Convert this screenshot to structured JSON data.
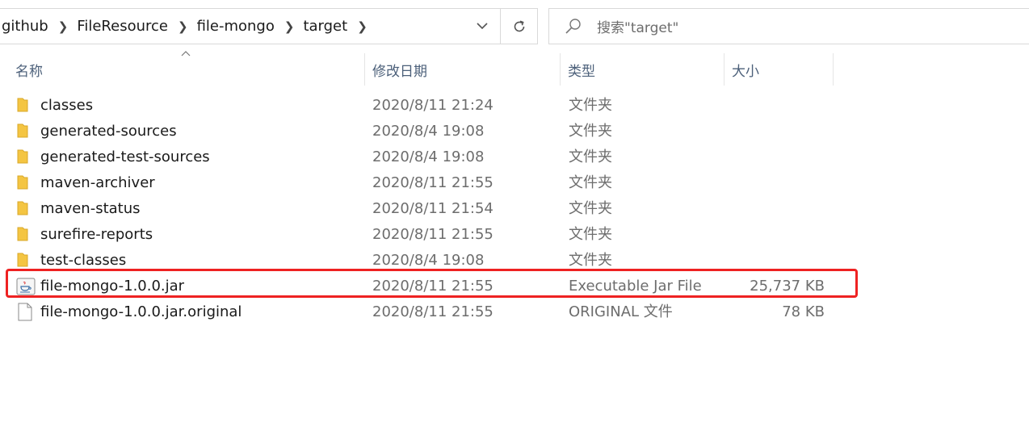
{
  "address_bar": {
    "crumbs": [
      "github",
      "FileResource",
      "file-mongo",
      "target"
    ]
  },
  "search": {
    "placeholder": "搜索\"target\""
  },
  "columns": {
    "name": "名称",
    "date": "修改日期",
    "type": "类型",
    "size": "大小"
  },
  "files": [
    {
      "name": "classes",
      "date": "2020/8/11 21:24",
      "type": "文件夹",
      "size": "",
      "icon": "folder-icon"
    },
    {
      "name": "generated-sources",
      "date": "2020/8/4 19:08",
      "type": "文件夹",
      "size": "",
      "icon": "folder-icon"
    },
    {
      "name": "generated-test-sources",
      "date": "2020/8/4 19:08",
      "type": "文件夹",
      "size": "",
      "icon": "folder-icon"
    },
    {
      "name": "maven-archiver",
      "date": "2020/8/11 21:55",
      "type": "文件夹",
      "size": "",
      "icon": "folder-icon"
    },
    {
      "name": "maven-status",
      "date": "2020/8/11 21:54",
      "type": "文件夹",
      "size": "",
      "icon": "folder-icon"
    },
    {
      "name": "surefire-reports",
      "date": "2020/8/11 21:55",
      "type": "文件夹",
      "size": "",
      "icon": "folder-icon"
    },
    {
      "name": "test-classes",
      "date": "2020/8/4 19:08",
      "type": "文件夹",
      "size": "",
      "icon": "folder-icon"
    },
    {
      "name": "file-mongo-1.0.0.jar",
      "date": "2020/8/11 21:55",
      "type": "Executable Jar File",
      "size": "25,737 KB",
      "icon": "jar-file-icon"
    },
    {
      "name": "file-mongo-1.0.0.jar.original",
      "date": "2020/8/11 21:55",
      "type": "ORIGINAL 文件",
      "size": "78 KB",
      "icon": "blank-file-icon"
    }
  ],
  "colors": {
    "highlight": "#ee2222",
    "folder": "#f4c542",
    "header_text": "#4c607a"
  }
}
